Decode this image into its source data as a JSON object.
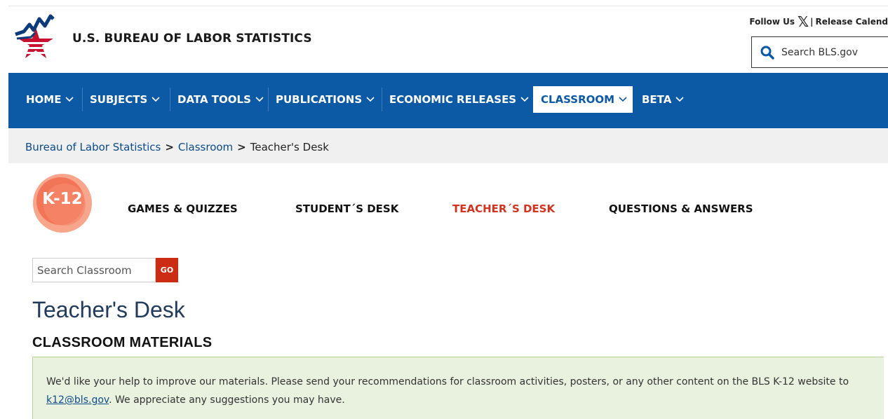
{
  "header": {
    "site_title": "U.S. BUREAU OF LABOR STATISTICS",
    "follow_label": "Follow Us",
    "separator": "|",
    "release_calendar": "Release Calend",
    "search_placeholder": "Search BLS.gov"
  },
  "nav": {
    "items": [
      {
        "label": "HOME"
      },
      {
        "label": "SUBJECTS"
      },
      {
        "label": "DATA TOOLS"
      },
      {
        "label": "PUBLICATIONS"
      },
      {
        "label": "ECONOMIC RELEASES"
      },
      {
        "label": "CLASSROOM",
        "active": true
      },
      {
        "label": "BETA"
      }
    ]
  },
  "breadcrumb": {
    "items": [
      "Bureau of Labor Statistics",
      "Classroom",
      "Teacher's Desk"
    ]
  },
  "k12": {
    "badge": "K-12",
    "links": [
      "GAMES & QUIZZES",
      "STUDENT´S DESK",
      "TEACHER´S DESK",
      "QUESTIONS & ANSWERS"
    ],
    "active": "TEACHER´S DESK"
  },
  "classroom_search": {
    "placeholder": "Search Classroom",
    "button": "GO"
  },
  "main": {
    "title": "Teacher's Desk",
    "section": "CLASSROOM MATERIALS",
    "notice_before": "We'd like your help to improve our materials. Please send your recommendations for classroom activities, posters, or any other content on the BLS K-12 website to ",
    "notice_link": "k12@bls.gov",
    "notice_after": ". We appreciate any suggestions you may have."
  },
  "colors": {
    "nav_blue": "#0c5aa6",
    "accent_red": "#cc2b14",
    "k12_orange": "#f26c4f",
    "notice_green": "#e9f1df"
  }
}
